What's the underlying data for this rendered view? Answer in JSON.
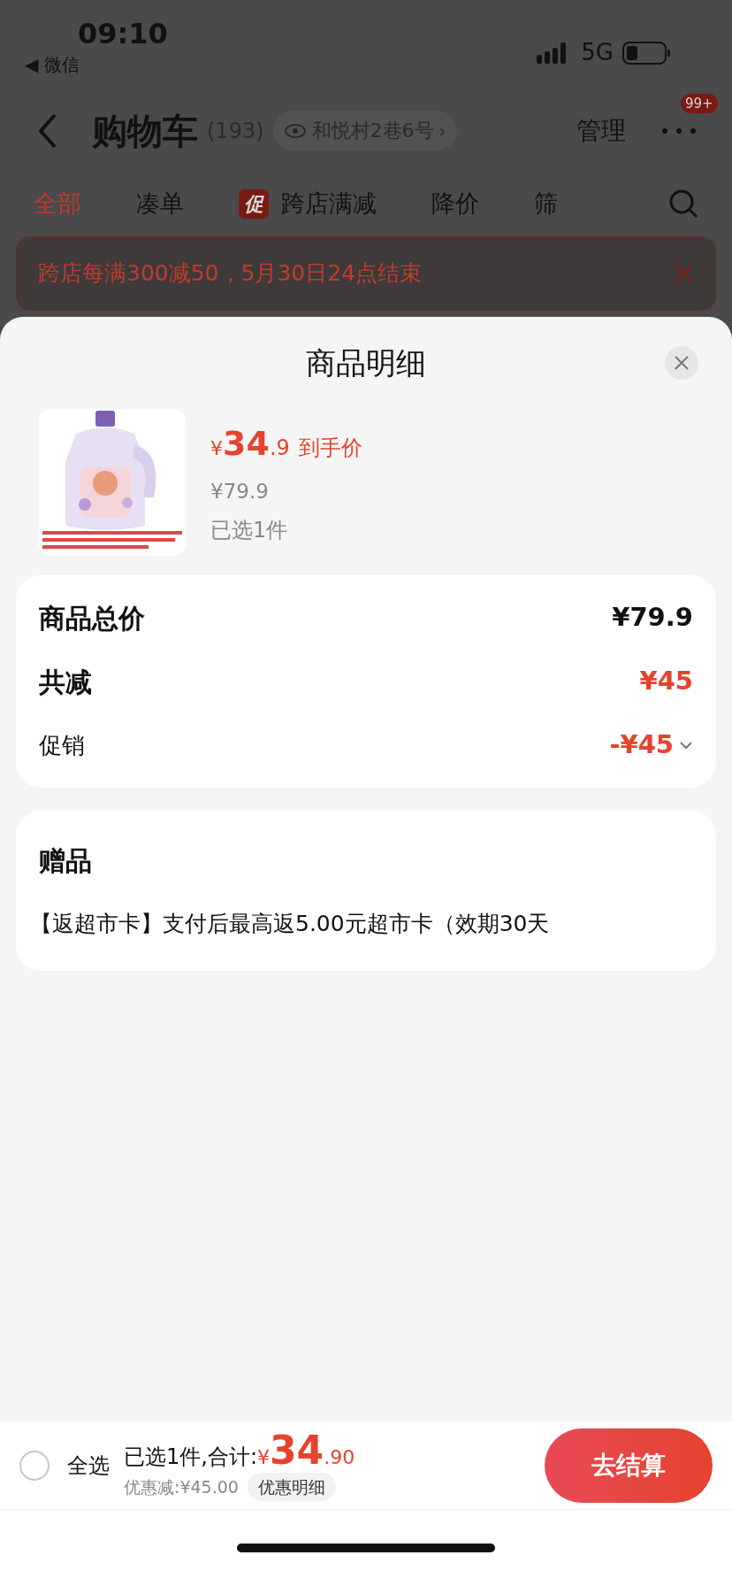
{
  "status_bar": {
    "time": "09:10",
    "back_app": "◀ 微信",
    "network": "5G"
  },
  "header": {
    "title": "购物车",
    "count": "(193)",
    "address": "和悦村2巷6号",
    "address_arrow": "›",
    "manage": "管理",
    "more_badge": "99+"
  },
  "tabs": [
    {
      "label": "全部",
      "selected": true
    },
    {
      "label": "凑单",
      "selected": false
    },
    {
      "label": "跨店满减",
      "badge": "促",
      "selected": false
    },
    {
      "label": "降价",
      "selected": false
    },
    {
      "label": "筛",
      "selected": false
    }
  ],
  "promo_banner": {
    "text": "跨店每满300减50，5月30日24点结束"
  },
  "sheet": {
    "title": "商品明细",
    "product": {
      "kind": "picture",
      "price_currency": "¥",
      "price_integer": "34",
      "price_decimal": ".9",
      "price_label": "到手价",
      "original_price": "¥79.9",
      "selected_count": "已选1件"
    },
    "summary": [
      {
        "label": "商品总价",
        "value": "¥79.9",
        "kind": "total"
      },
      {
        "label": "共减",
        "value": "¥45",
        "kind": "discount"
      },
      {
        "label": "促销",
        "value": "-¥45",
        "kind": "promo"
      }
    ],
    "gift": {
      "title": "赠品",
      "text": "【返超市卡】支付后最高返5.00元超市卡（效期30天"
    }
  },
  "bottom_bar": {
    "select_all": {
      "label": "全选",
      "checked": false
    },
    "summary_prefix": "已选1件,合计:",
    "total_currency": "¥",
    "total_integer": "34",
    "total_decimal": ".90",
    "saving": "优惠减:¥45.00",
    "detail_button": "优惠明细",
    "checkout": "去结算"
  }
}
